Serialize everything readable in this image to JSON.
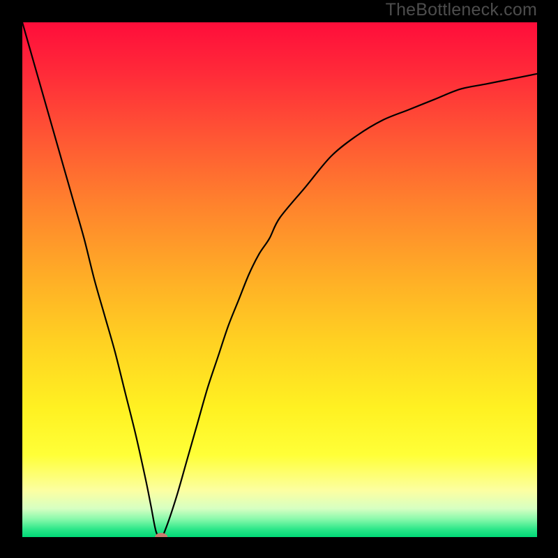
{
  "watermark": "TheBottleneck.com",
  "chart_data": {
    "type": "line",
    "title": "",
    "xlabel": "",
    "ylabel": "",
    "xlim": [
      0,
      100
    ],
    "ylim": [
      0,
      100
    ],
    "grid": false,
    "legend": false,
    "x": [
      0,
      2,
      4,
      6,
      8,
      10,
      12,
      14,
      16,
      18,
      20,
      22,
      24,
      25,
      26,
      27,
      28,
      30,
      32,
      34,
      36,
      38,
      40,
      42,
      44,
      46,
      48,
      50,
      55,
      60,
      65,
      70,
      75,
      80,
      85,
      90,
      95,
      100
    ],
    "values": [
      100,
      93,
      86,
      79,
      72,
      65,
      58,
      50,
      43,
      36,
      28,
      20,
      11,
      6,
      1,
      0,
      2,
      8,
      15,
      22,
      29,
      35,
      41,
      46,
      51,
      55,
      58,
      62,
      68,
      74,
      78,
      81,
      83,
      85,
      87,
      88,
      89,
      90
    ],
    "optimum": {
      "x": 27,
      "y": 0
    },
    "background": {
      "type": "vertical-gradient",
      "stops": [
        {
          "offset": 0.0,
          "color": "#ff0d3a"
        },
        {
          "offset": 0.1,
          "color": "#ff2b39"
        },
        {
          "offset": 0.22,
          "color": "#ff5534"
        },
        {
          "offset": 0.35,
          "color": "#ff812d"
        },
        {
          "offset": 0.5,
          "color": "#ffaf26"
        },
        {
          "offset": 0.62,
          "color": "#ffd122"
        },
        {
          "offset": 0.75,
          "color": "#fff122"
        },
        {
          "offset": 0.84,
          "color": "#ffff37"
        },
        {
          "offset": 0.91,
          "color": "#fcffa2"
        },
        {
          "offset": 0.945,
          "color": "#d6ffc2"
        },
        {
          "offset": 0.965,
          "color": "#89f9ab"
        },
        {
          "offset": 0.985,
          "color": "#2be789"
        },
        {
          "offset": 1.0,
          "color": "#00d977"
        }
      ]
    },
    "marker": {
      "x": 27,
      "y": 0,
      "color": "#c97c6f",
      "rx": 9,
      "ry": 6
    }
  }
}
